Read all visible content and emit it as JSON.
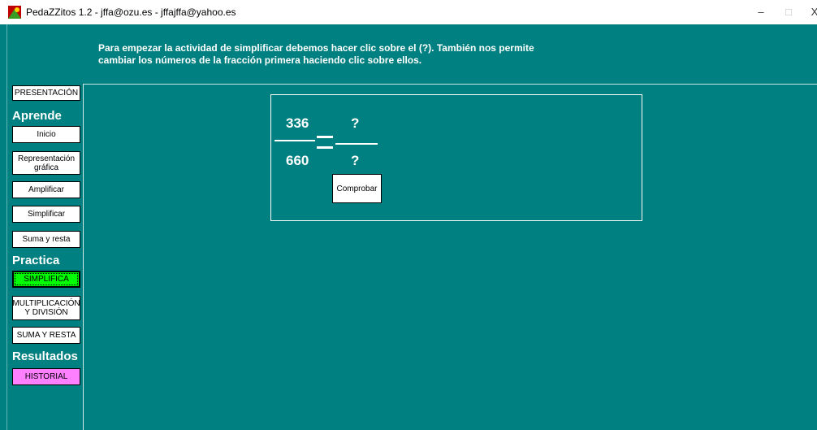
{
  "window": {
    "title": "PedaZZitos 1.2 - jffa@ozu.es - jffajffa@yahoo.es",
    "minimize": "–",
    "maximize": "□",
    "close": "X"
  },
  "instructions": {
    "line1": "Para empezar la actividad de simplificar debemos hacer clic sobre el (?). También nos permite",
    "line2": "cambiar los números de la fracción primera haciendo clic sobre ellos."
  },
  "sidebar": {
    "presentacion": "PRESENTACIÓN",
    "aprende_heading": "Aprende",
    "aprende_items": [
      "Inicio",
      "Representación gráfica",
      "Amplificar",
      "Simplificar",
      "Suma y resta"
    ],
    "practica_heading": "Practica",
    "practica_items": [
      "SIMPLIFICA",
      "MULTIPLICACIÓN Y DIVISIÓN",
      "SUMA Y RESTA"
    ],
    "resultados_heading": "Resultados",
    "historial": "HISTORIAL",
    "colors": {
      "simplifica_active": "#00ff00",
      "historial": "#ff80ff"
    }
  },
  "exercise": {
    "numerator": "336",
    "denominator": "660",
    "result_numerator": "?",
    "result_denominator": "?",
    "check_label": "Comprobar"
  },
  "colors": {
    "background": "#008080"
  }
}
